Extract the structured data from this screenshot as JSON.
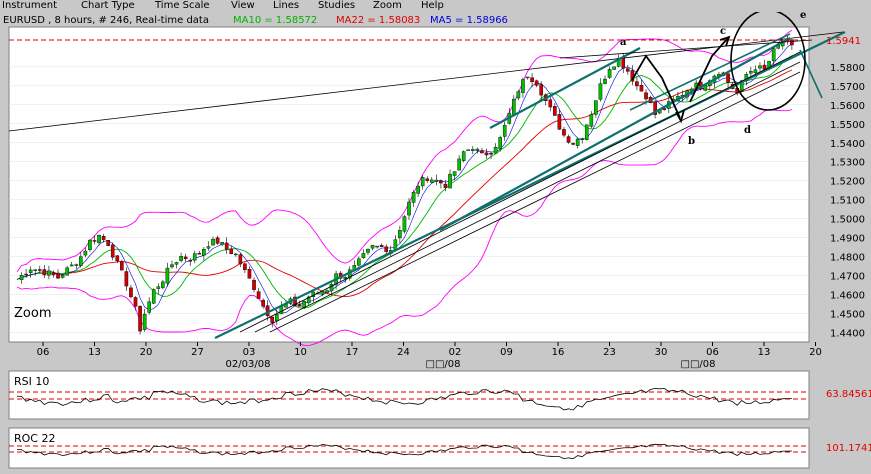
{
  "menu": {
    "items": [
      "Instrument",
      "Chart Type",
      "Time Scale",
      "View",
      "Lines",
      "Studies",
      "Zoom",
      "Help"
    ]
  },
  "header": {
    "symbol_info": "EURUSD , 8 hours, # 246, Real-time data",
    "ma10": "MA10 = 1.58572",
    "ma22": "MA22 = 1.58083",
    "ma5": "MA5 = 1.58966"
  },
  "colors": {
    "ma10": "#00b400",
    "ma22": "#e00000",
    "ma5": "#0000e0",
    "bollinger": "#ff00ff",
    "candle_up": "#00c000",
    "candle_down": "#d00000",
    "trendline": "#0f6e6e"
  },
  "zoom_label": "Zoom",
  "annotations": {
    "a": "a",
    "b": "b",
    "c": "c",
    "d": "d",
    "e": "e"
  },
  "resistance_label": "1.5941",
  "chart_data": {
    "type": "candlestick",
    "y_ticks": [
      "1.5800",
      "1.5700",
      "1.5600",
      "1.5500",
      "1.5400",
      "1.5300",
      "1.5200",
      "1.5100",
      "1.5000",
      "1.4900",
      "1.4800",
      "1.4700",
      "1.4600",
      "1.4500",
      "1.4400"
    ],
    "ylim": [
      1.435,
      1.601
    ],
    "x_ticks": [
      "06",
      "13",
      "20",
      "27",
      "03",
      "10",
      "17",
      "24",
      "02",
      "09",
      "16",
      "23",
      "30",
      "06",
      "13",
      "20"
    ],
    "x_sublabels": [
      "02/03/08",
      "□□/08",
      "□□/08"
    ],
    "resistance": 1.5941,
    "close_path": [
      [
        0,
        1.468
      ],
      [
        3,
        1.474
      ],
      [
        6,
        1.472
      ],
      [
        9,
        1.469
      ],
      [
        12,
        1.475
      ],
      [
        14,
        1.48
      ],
      [
        16,
        1.488
      ],
      [
        18,
        1.491
      ],
      [
        20,
        1.487
      ],
      [
        22,
        1.476
      ],
      [
        24,
        1.466
      ],
      [
        26,
        1.452
      ],
      [
        27,
        1.442
      ],
      [
        28,
        1.45
      ],
      [
        30,
        1.462
      ],
      [
        32,
        1.468
      ],
      [
        34,
        1.476
      ],
      [
        36,
        1.48
      ],
      [
        38,
        1.479
      ],
      [
        40,
        1.482
      ],
      [
        42,
        1.487
      ],
      [
        44,
        1.488
      ],
      [
        46,
        1.484
      ],
      [
        48,
        1.481
      ],
      [
        50,
        1.472
      ],
      [
        52,
        1.464
      ],
      [
        54,
        1.454
      ],
      [
        56,
        1.447
      ],
      [
        58,
        1.453
      ],
      [
        60,
        1.456
      ],
      [
        62,
        1.454
      ],
      [
        64,
        1.459
      ],
      [
        66,
        1.461
      ],
      [
        68,
        1.463
      ],
      [
        70,
        1.47
      ],
      [
        72,
        1.47
      ],
      [
        74,
        1.474
      ],
      [
        76,
        1.48
      ],
      [
        78,
        1.485
      ],
      [
        80,
        1.485
      ],
      [
        82,
        1.484
      ],
      [
        84,
        1.495
      ],
      [
        86,
        1.508
      ],
      [
        88,
        1.518
      ],
      [
        90,
        1.522
      ],
      [
        92,
        1.52
      ],
      [
        94,
        1.518
      ],
      [
        96,
        1.525
      ],
      [
        98,
        1.535
      ],
      [
        100,
        1.538
      ],
      [
        102,
        1.533
      ],
      [
        104,
        1.536
      ],
      [
        106,
        1.542
      ],
      [
        108,
        1.555
      ],
      [
        110,
        1.568
      ],
      [
        112,
        1.576
      ],
      [
        114,
        1.572
      ],
      [
        116,
        1.562
      ],
      [
        118,
        1.553
      ],
      [
        120,
        1.544
      ],
      [
        122,
        1.54
      ],
      [
        124,
        1.544
      ],
      [
        126,
        1.556
      ],
      [
        128,
        1.57
      ],
      [
        130,
        1.58
      ],
      [
        132,
        1.584
      ],
      [
        134,
        1.578
      ],
      [
        136,
        1.57
      ],
      [
        138,
        1.565
      ],
      [
        140,
        1.555
      ],
      [
        142,
        1.558
      ],
      [
        144,
        1.562
      ],
      [
        146,
        1.566
      ],
      [
        148,
        1.57
      ],
      [
        150,
        1.57
      ],
      [
        152,
        1.574
      ],
      [
        154,
        1.578
      ],
      [
        156,
        1.572
      ],
      [
        158,
        1.566
      ],
      [
        160,
        1.576
      ],
      [
        162,
        1.58
      ],
      [
        164,
        1.578
      ],
      [
        166,
        1.588
      ],
      [
        168,
        1.594
      ],
      [
        170,
        1.59
      ]
    ],
    "rsi": {
      "label": "RSI 10",
      "level": "63.84561"
    },
    "roc": {
      "label": "ROC 22",
      "level": "101.1741"
    }
  }
}
